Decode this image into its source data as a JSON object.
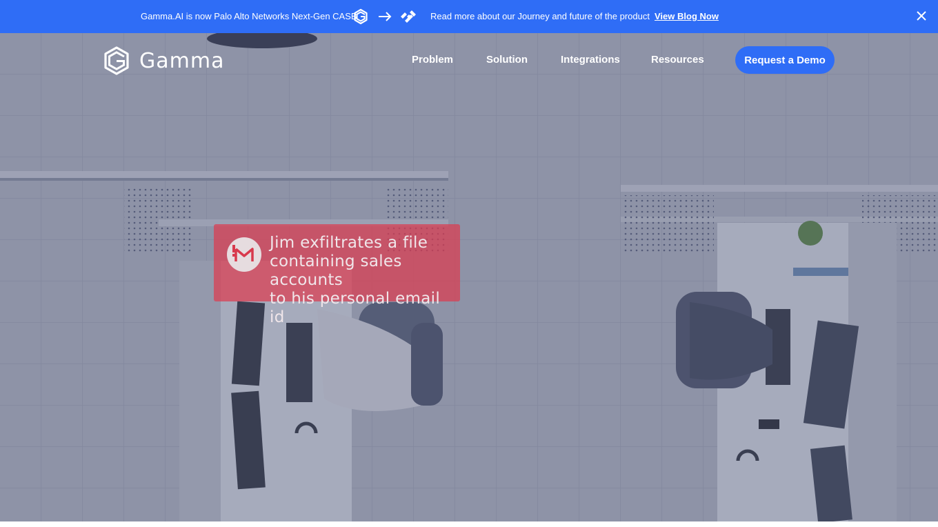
{
  "announcement": {
    "text_left": "Gamma.AI is now Palo Alto Networks Next-Gen CASB",
    "text_right": "Read more about our Journey and future of the product",
    "link_label": "View Blog Now",
    "icons": [
      "gamma-mark-icon",
      "arrow-right-icon",
      "palo-alto-networks-icon",
      "close-icon"
    ]
  },
  "nav": {
    "logo_text": "Gamma",
    "items": [
      {
        "label": "Problem"
      },
      {
        "label": "Solution"
      },
      {
        "label": "Integrations"
      },
      {
        "label": "Resources"
      }
    ],
    "cta_label": "Request a Demo"
  },
  "hero": {
    "alert_icon": "gmail-alert-icon",
    "alert_lines": [
      "Jim exfiltrates a file",
      "containing sales accounts",
      "to his personal email id"
    ]
  },
  "colors": {
    "brand_blue": "#2f6df6",
    "alert_red": "#dc3c50",
    "white": "#ffffff"
  }
}
